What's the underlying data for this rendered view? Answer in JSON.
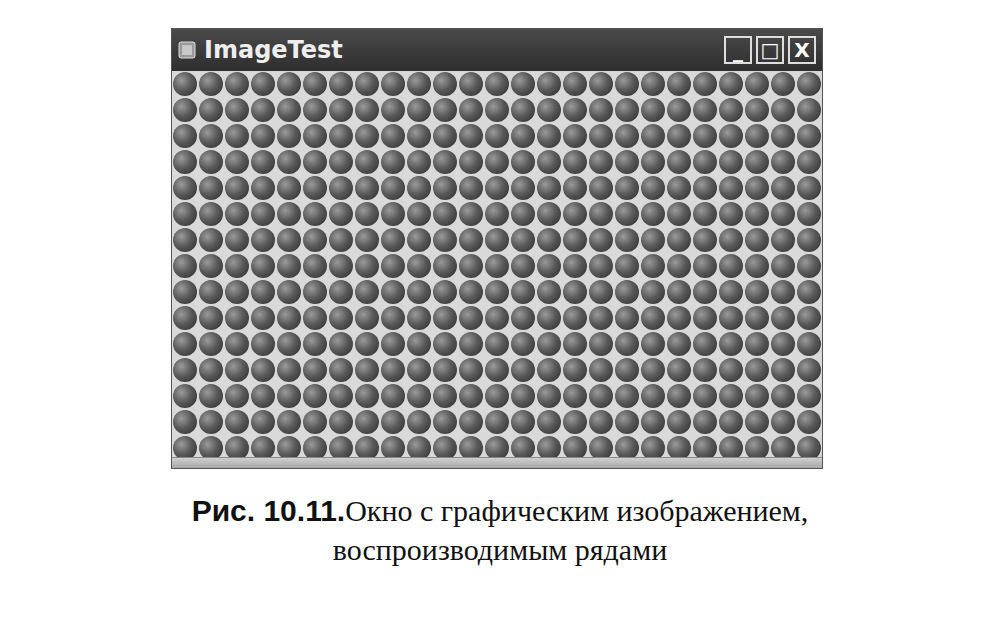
{
  "window": {
    "title": "ImageTest",
    "buttons": [
      "_",
      "□",
      "X"
    ]
  },
  "tile_grid": {
    "columns": 25,
    "rows": 15
  },
  "caption": {
    "label": "Рис. 10.11.",
    "text": "Окно с графическим изображением, воспроизводимым рядами"
  }
}
